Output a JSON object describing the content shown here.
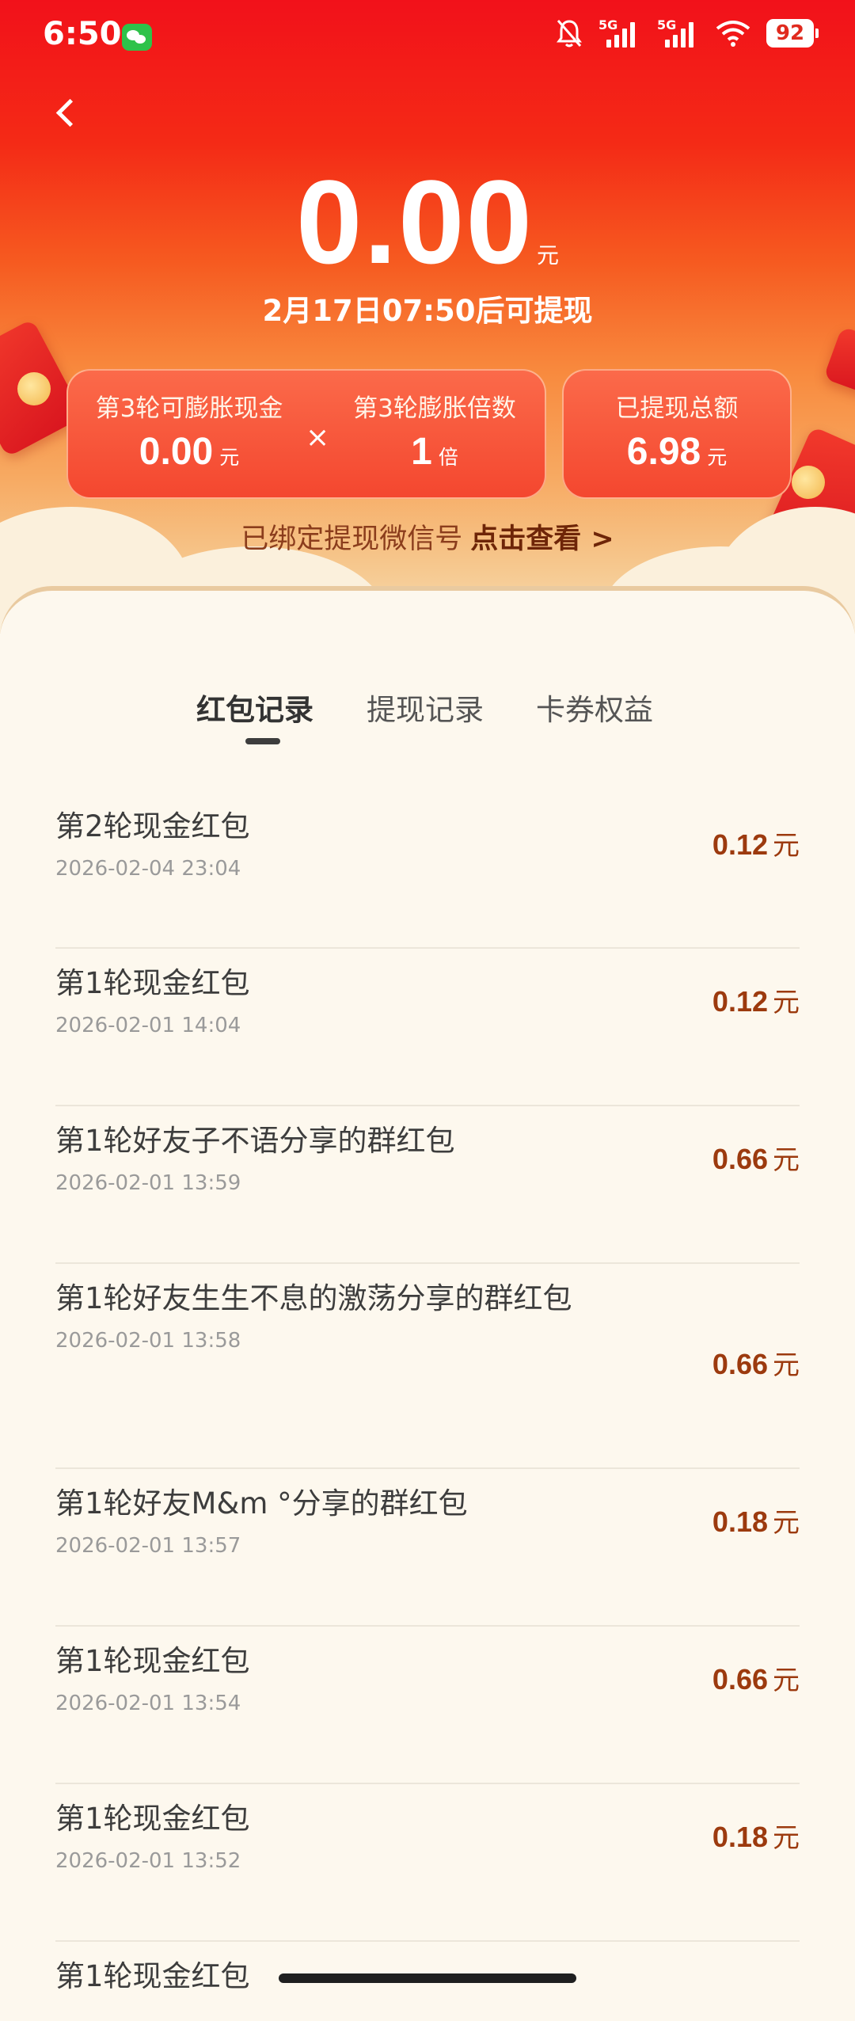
{
  "statusbar": {
    "time": "6:50",
    "network_1": "5G",
    "network_2": "5G",
    "battery": "92"
  },
  "balance": {
    "amount": "0.00",
    "unit": "元",
    "withdraw_time": "2月17日07:50后可提现"
  },
  "cards": {
    "left": {
      "item1_label": "第3轮可膨胀现金",
      "item1_value": "0.00",
      "item1_unit": "元",
      "times": "×",
      "item2_label": "第3轮膨胀倍数",
      "item2_value": "1",
      "item2_unit": "倍"
    },
    "right": {
      "label": "已提现总额",
      "value": "6.98",
      "unit": "元"
    }
  },
  "bind": {
    "text": "已绑定提现微信号",
    "link": "点击查看 >"
  },
  "tabs": [
    {
      "label": "红包记录",
      "active": true
    },
    {
      "label": "提现记录",
      "active": false
    },
    {
      "label": "卡券权益",
      "active": false
    }
  ],
  "records": [
    {
      "title": "第2轮现金红包",
      "date": "2026-02-04 23:04",
      "amount": "0.12",
      "unit": "元"
    },
    {
      "title": "第1轮现金红包",
      "date": "2026-02-01 14:04",
      "amount": "0.12",
      "unit": "元"
    },
    {
      "title": "第1轮好友子不语分享的群红包",
      "date": "2026-02-01 13:59",
      "amount": "0.66",
      "unit": "元"
    },
    {
      "title": "第1轮好友生生不息的激荡分享的群红包",
      "date": "2026-02-01 13:58",
      "amount": "0.66",
      "unit": "元"
    },
    {
      "title": "第1轮好友M&m °分享的群红包",
      "date": "2026-02-01 13:57",
      "amount": "0.18",
      "unit": "元"
    },
    {
      "title": "第1轮现金红包",
      "date": "2026-02-01 13:54",
      "amount": "0.66",
      "unit": "元"
    },
    {
      "title": "第1轮现金红包",
      "date": "2026-02-01 13:52",
      "amount": "0.18",
      "unit": "元"
    },
    {
      "title": "第1轮现金红包",
      "date": "",
      "amount": "",
      "unit": ""
    }
  ]
}
